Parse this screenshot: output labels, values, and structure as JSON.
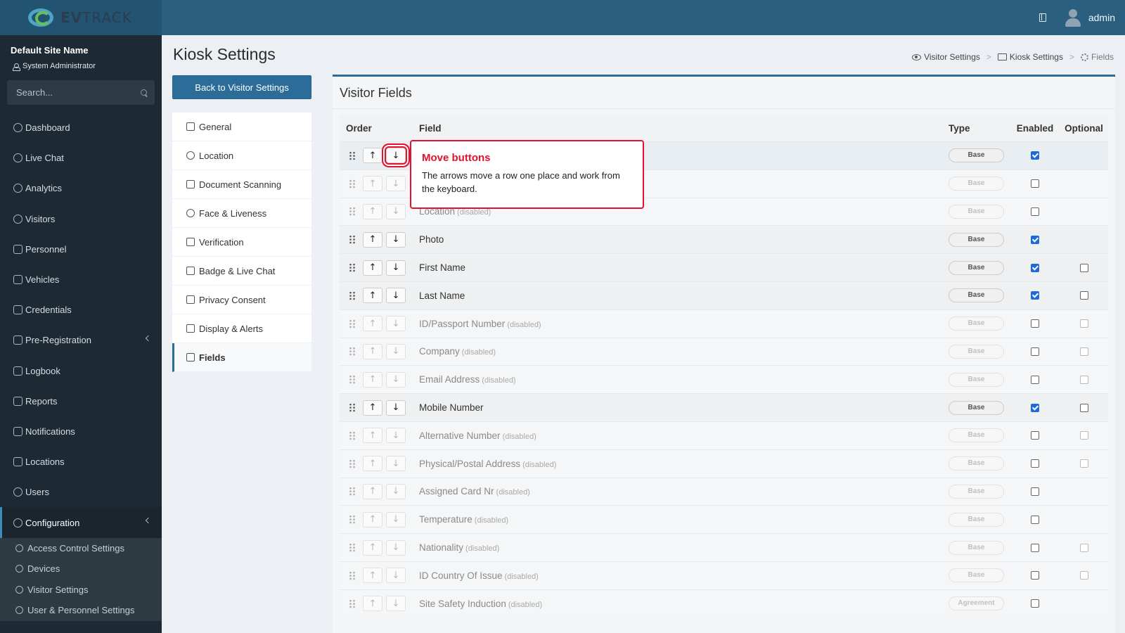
{
  "header": {
    "logo_text_bold": "EV",
    "logo_text": "TRACK",
    "user": "admin"
  },
  "sidebar": {
    "site_name": "Default Site Name",
    "role": "System Administrator",
    "search_placeholder": "Search...",
    "items": [
      {
        "label": "Dashboard",
        "icon": "dashboard-icon"
      },
      {
        "label": "Live Chat",
        "icon": "headset-icon"
      },
      {
        "label": "Analytics",
        "icon": "analytics-icon"
      },
      {
        "label": "Visitors",
        "icon": "eye-icon"
      },
      {
        "label": "Personnel",
        "icon": "people-icon"
      },
      {
        "label": "Vehicles",
        "icon": "car-icon"
      },
      {
        "label": "Credentials",
        "icon": "credentials-icon"
      },
      {
        "label": "Pre-Registration",
        "icon": "arrows-icon"
      },
      {
        "label": "Logbook",
        "icon": "book-icon"
      },
      {
        "label": "Reports",
        "icon": "reports-icon"
      },
      {
        "label": "Notifications",
        "icon": "notifications-icon"
      },
      {
        "label": "Locations",
        "icon": "map-icon"
      },
      {
        "label": "Users",
        "icon": "users-icon"
      },
      {
        "label": "Configuration",
        "icon": "gear-icon"
      }
    ],
    "subitems": [
      {
        "label": "Access Control Settings",
        "icon": "lock-icon"
      },
      {
        "label": "Devices",
        "icon": "devices-icon"
      },
      {
        "label": "Visitor Settings",
        "icon": "eye-icon"
      },
      {
        "label": "User & Personnel Settings",
        "icon": "users-icon"
      }
    ]
  },
  "page": {
    "title": "Kiosk Settings",
    "breadcrumbs": [
      "Visitor Settings",
      "Kiosk Settings",
      "Fields"
    ],
    "back_button": "Back to Visitor Settings",
    "settings_menu": [
      "General",
      "Location",
      "Document Scanning",
      "Face & Liveness",
      "Verification",
      "Badge & Live Chat",
      "Privacy Consent",
      "Display & Alerts",
      "Fields"
    ]
  },
  "panel": {
    "title": "Visitor Fields",
    "columns": [
      "Order",
      "Field",
      "Type",
      "Enabled",
      "Optional"
    ],
    "disabled_suffix": "(disabled)",
    "rows": [
      {
        "field": "",
        "type": "Base",
        "enabled": true,
        "optional": null,
        "disabled": false
      },
      {
        "field": "",
        "type": "Base",
        "enabled": false,
        "optional": null,
        "disabled": true
      },
      {
        "field": "Location",
        "type": "Base",
        "enabled": false,
        "optional": null,
        "disabled": true
      },
      {
        "field": "Photo",
        "type": "Base",
        "enabled": true,
        "optional": null,
        "disabled": false
      },
      {
        "field": "First Name",
        "type": "Base",
        "enabled": true,
        "optional": false,
        "disabled": false
      },
      {
        "field": "Last Name",
        "type": "Base",
        "enabled": true,
        "optional": false,
        "disabled": false
      },
      {
        "field": "ID/Passport Number",
        "type": "Base",
        "enabled": false,
        "optional": false,
        "disabled": true
      },
      {
        "field": "Company",
        "type": "Base",
        "enabled": false,
        "optional": false,
        "disabled": true
      },
      {
        "field": "Email Address",
        "type": "Base",
        "enabled": false,
        "optional": false,
        "disabled": true
      },
      {
        "field": "Mobile Number",
        "type": "Base",
        "enabled": true,
        "optional": false,
        "disabled": false
      },
      {
        "field": "Alternative Number",
        "type": "Base",
        "enabled": false,
        "optional": false,
        "disabled": true
      },
      {
        "field": "Physical/Postal Address",
        "type": "Base",
        "enabled": false,
        "optional": false,
        "disabled": true
      },
      {
        "field": "Assigned Card Nr",
        "type": "Base",
        "enabled": false,
        "optional": null,
        "disabled": true
      },
      {
        "field": "Temperature",
        "type": "Base",
        "enabled": false,
        "optional": null,
        "disabled": true
      },
      {
        "field": "Nationality",
        "type": "Base",
        "enabled": false,
        "optional": false,
        "disabled": true
      },
      {
        "field": "ID Country Of Issue",
        "type": "Base",
        "enabled": false,
        "optional": false,
        "disabled": true
      },
      {
        "field": "Site Safety Induction",
        "type": "Agreement",
        "enabled": false,
        "optional": null,
        "disabled": true
      }
    ]
  },
  "callout": {
    "title": "Move buttons",
    "body": "The arrows move a row one place and work from the keyboard."
  },
  "colors": {
    "header": "#2a5f7f",
    "sidebar": "#1e2a33",
    "accent": "#2b6d98",
    "callout": "#e3122d",
    "checkbox": "#1e6bd6"
  }
}
